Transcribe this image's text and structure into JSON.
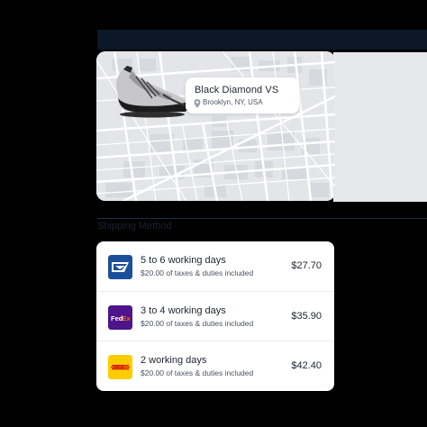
{
  "product": {
    "name": "Black Diamond VS",
    "location": "Brooklyn, NY, USA"
  },
  "shipping": {
    "section_title": "Shipping Method",
    "options": [
      {
        "carrier": "usps-logo",
        "time": "5 to 6 working days",
        "tax": "$20.00 of taxes & duties included",
        "price": "$27.70"
      },
      {
        "carrier": "fedex-logo",
        "time": "3 to 4 working days",
        "tax": "$20.00 of taxes & duties included",
        "price": "$35.90"
      },
      {
        "carrier": "dhl-logo",
        "time": "2 working days",
        "tax": "$20.00 of taxes & duties included",
        "price": "$42.40"
      }
    ]
  },
  "colors": {
    "usps": "#1b4f9c",
    "fedex": "#4d148c",
    "dhl": "#ffcc00"
  }
}
